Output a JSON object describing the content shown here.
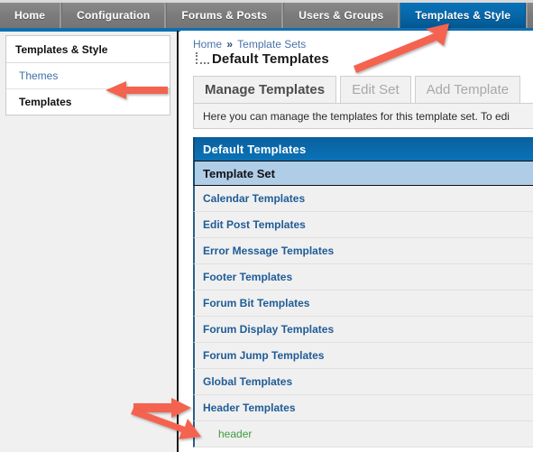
{
  "topnav": {
    "tabs": [
      {
        "label": "Home",
        "active": false
      },
      {
        "label": "Configuration",
        "active": false
      },
      {
        "label": "Forums & Posts",
        "active": false
      },
      {
        "label": "Users & Groups",
        "active": false
      },
      {
        "label": "Templates & Style",
        "active": true
      }
    ],
    "active_color": "#0a6aab",
    "inactive_color": "#7c7c7c"
  },
  "sidebar": {
    "title": "Templates & Style",
    "items": [
      {
        "label": "Themes",
        "current": false
      },
      {
        "label": "Templates",
        "current": true
      }
    ]
  },
  "content": {
    "breadcrumb": {
      "home": "Home",
      "separator": "»",
      "parent": "Template Sets"
    },
    "page_title": "Default Templates",
    "tabs": [
      {
        "label": "Manage Templates",
        "active": true
      },
      {
        "label": "Edit Set",
        "active": false
      },
      {
        "label": "Add Template",
        "active": false
      }
    ],
    "description": "Here you can manage the templates for this template set. To edi",
    "table": {
      "header": "Default Templates",
      "subheader": "Template Set",
      "rows": [
        {
          "label": "Calendar Templates",
          "type": "category"
        },
        {
          "label": "Edit Post Templates",
          "type": "category"
        },
        {
          "label": "Error Message Templates",
          "type": "category"
        },
        {
          "label": "Footer Templates",
          "type": "category"
        },
        {
          "label": "Forum Bit Templates",
          "type": "category"
        },
        {
          "label": "Forum Display Templates",
          "type": "category"
        },
        {
          "label": "Forum Jump Templates",
          "type": "category"
        },
        {
          "label": "Global Templates",
          "type": "category"
        },
        {
          "label": "Header Templates",
          "type": "category"
        },
        {
          "label": "header",
          "type": "child"
        }
      ]
    }
  },
  "annotations": {
    "color": "#f4634f",
    "arrows": [
      {
        "name": "arrow-to-templates-sidebar",
        "direction": "left"
      },
      {
        "name": "arrow-to-templates-style-tab",
        "direction": "up-right"
      },
      {
        "name": "arrow-to-header-templates-row",
        "direction": "right"
      },
      {
        "name": "arrow-to-header-child-row",
        "direction": "down-right"
      }
    ]
  }
}
